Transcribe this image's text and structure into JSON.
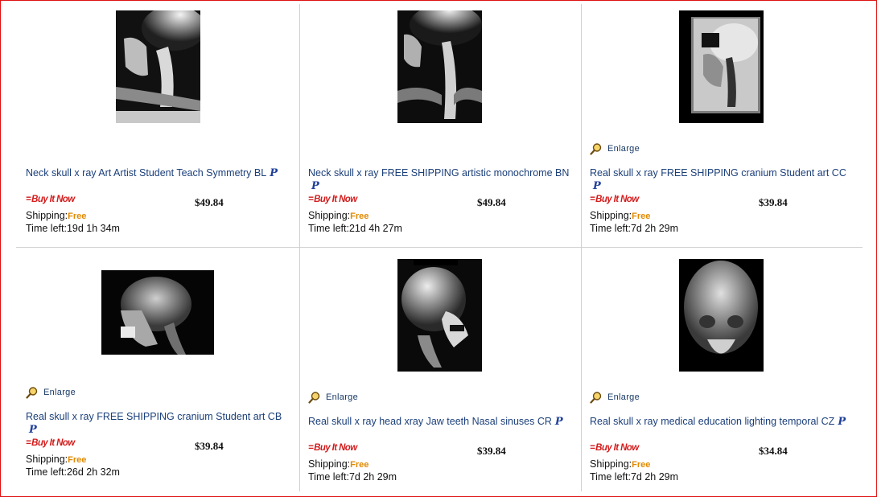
{
  "listings": [
    {
      "title": "Neck skull x ray Art Artist Student Teach Symmetry BL",
      "has_enlarge": false,
      "buy_label": "Buy It Now",
      "price": "$49.84",
      "shipping_label": "Shipping:",
      "shipping_value": "Free",
      "time_left_label": "Time left:",
      "time_left": "19d 1h 34m"
    },
    {
      "title": "Neck skull x ray FREE SHIPPING artistic monochrome BN",
      "has_enlarge": false,
      "buy_label": "Buy It Now",
      "price": "$49.84",
      "shipping_label": "Shipping:",
      "shipping_value": "Free",
      "time_left_label": "Time left:",
      "time_left": "21d 4h 27m"
    },
    {
      "title": "Real skull x ray FREE SHIPPING cranium Student art CC",
      "has_enlarge": true,
      "enlarge_label": "Enlarge",
      "buy_label": "Buy It Now",
      "price": "$39.84",
      "shipping_label": "Shipping:",
      "shipping_value": "Free",
      "time_left_label": "Time left:",
      "time_left": "7d 2h 29m"
    },
    {
      "title": "Real skull x ray FREE SHIPPING cranium Student art CB",
      "has_enlarge": true,
      "enlarge_label": "Enlarge",
      "buy_label": "Buy It Now",
      "price": "$39.84",
      "shipping_label": "Shipping:",
      "shipping_value": "Free",
      "time_left_label": "Time left:",
      "time_left": "26d 2h 32m"
    },
    {
      "title": "Real skull x ray head xray Jaw teeth Nasal sinuses CR",
      "has_enlarge": true,
      "enlarge_label": "Enlarge",
      "buy_label": "Buy It Now",
      "price": "$39.84",
      "shipping_label": "Shipping:",
      "shipping_value": "Free",
      "time_left_label": "Time left:",
      "time_left": "7d 2h 29m"
    },
    {
      "title": "Real skull x ray medical education lighting temporal CZ",
      "has_enlarge": true,
      "enlarge_label": "Enlarge",
      "buy_label": "Buy It Now",
      "price": "$34.84",
      "shipping_label": "Shipping:",
      "shipping_value": "Free",
      "time_left_label": "Time left:",
      "time_left": "7d 2h 29m"
    }
  ],
  "paypal_mark": "P",
  "colors": {
    "border": "#e01010",
    "link": "#1b3f7a",
    "buy_now": "#d31a1a",
    "free": "#e08a00"
  }
}
